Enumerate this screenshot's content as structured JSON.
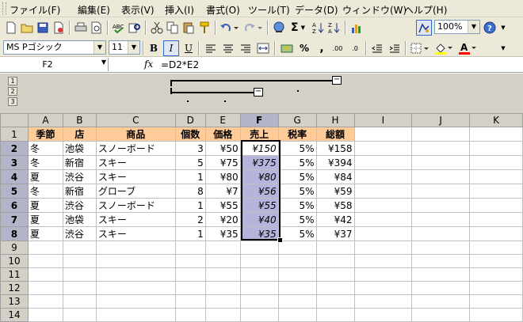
{
  "menu": [
    "ファイル(F)",
    "編集(E)",
    "表示(V)",
    "挿入(I)",
    "書式(O)",
    "ツール(T)",
    "データ(D)",
    "ウィンドウ(W)",
    "ヘルプ(H)"
  ],
  "toolbar": {
    "zoom": "100%",
    "autosum": "Σ",
    "help": "?"
  },
  "format": {
    "font": "MS Pゴシック",
    "size": "11",
    "bold": "B",
    "italic": "I",
    "underline": "U",
    "percent": "%",
    "comma": ",",
    "inc_dec": ".00",
    "dec_dec": ".0",
    "font_color_label": "A"
  },
  "formula_bar": {
    "cell": "F2",
    "fx": "fx",
    "formula": "=D2*E2"
  },
  "outline_levels": [
    "1",
    "2",
    "3"
  ],
  "columns": [
    "A",
    "B",
    "C",
    "D",
    "E",
    "F",
    "G",
    "H",
    "I",
    "J",
    "K"
  ],
  "header_row": [
    "季節",
    "店",
    "商品",
    "個数",
    "価格",
    "売上",
    "税率",
    "総額"
  ],
  "rows": [
    [
      "冬",
      "池袋",
      "スノーボード",
      "3",
      "¥50",
      "¥150",
      "5%",
      "¥158"
    ],
    [
      "冬",
      "新宿",
      "スキー",
      "5",
      "¥75",
      "¥375",
      "5%",
      "¥394"
    ],
    [
      "夏",
      "渋谷",
      "スキー",
      "1",
      "¥80",
      "¥80",
      "5%",
      "¥84"
    ],
    [
      "冬",
      "新宿",
      "グローブ",
      "8",
      "¥7",
      "¥56",
      "5%",
      "¥59"
    ],
    [
      "夏",
      "渋谷",
      "スノーボード",
      "1",
      "¥55",
      "¥55",
      "5%",
      "¥58"
    ],
    [
      "夏",
      "池袋",
      "スキー",
      "2",
      "¥20",
      "¥40",
      "5%",
      "¥42"
    ],
    [
      "夏",
      "渋谷",
      "スキー",
      "1",
      "¥35",
      "¥35",
      "5%",
      "¥37"
    ]
  ],
  "row_numbers": [
    "1",
    "2",
    "3",
    "4",
    "5",
    "6",
    "7",
    "8",
    "9",
    "10",
    "11",
    "12",
    "13",
    "14"
  ],
  "colors": {
    "header_fill": "#ffcc99",
    "selection": "#b4b4dc",
    "toolbar_bg": "#ece9d8"
  }
}
